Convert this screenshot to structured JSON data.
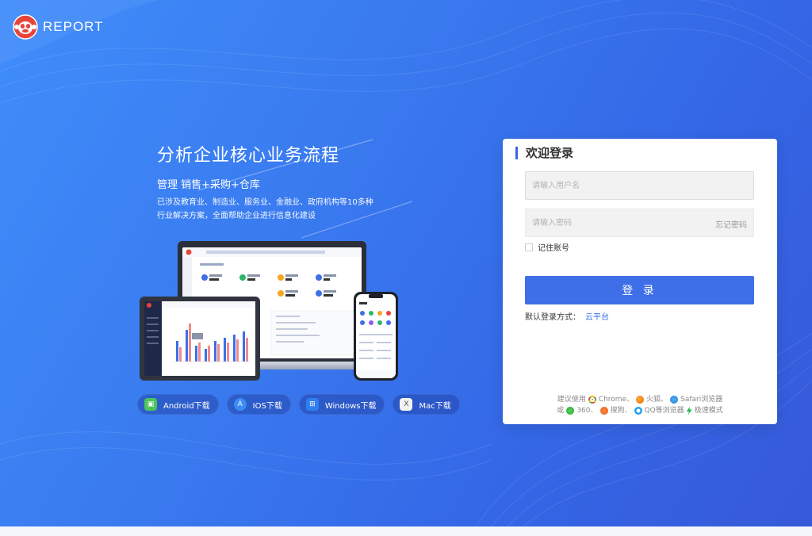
{
  "brand": {
    "name": "REPORT"
  },
  "hero": {
    "title": "分析企业核心业务流程",
    "subtitle": "管理 销售+采购+仓库",
    "desc_line1": "已涉及教育业、制造业、服务业、金融业、政府机构等10多种",
    "desc_line2": "行业解决方案，全面帮助企业进行信息化建设"
  },
  "downloads": [
    {
      "label": "Android下载",
      "icon": "android-icon"
    },
    {
      "label": "IOS下载",
      "icon": "appstore-icon"
    },
    {
      "label": "Windows下载",
      "icon": "windows-icon"
    },
    {
      "label": "Mac下载",
      "icon": "mac-icon"
    }
  ],
  "login": {
    "title": "欢迎登录",
    "username_placeholder": "请输入用户名",
    "username_value": "",
    "password_placeholder": "请输入密码",
    "password_value": "",
    "forgot": "忘记密码",
    "remember": "记住账号",
    "remember_checked": false,
    "submit": "登 录",
    "default_label": "默认登录方式：",
    "default_value": "云平台"
  },
  "browsers": {
    "prefix": "建议使用",
    "chrome": "Chrome、",
    "firefox": "火狐、",
    "safari": "Safari浏览器",
    "or": "或",
    "b360": "360、",
    "sogou": "搜狗、",
    "qq": "QQ等浏览器",
    "fast": "极速模式"
  },
  "colors": {
    "primary": "#3e6fe8",
    "bg_start": "#3f8dfb",
    "bg_end": "#3659d9"
  }
}
